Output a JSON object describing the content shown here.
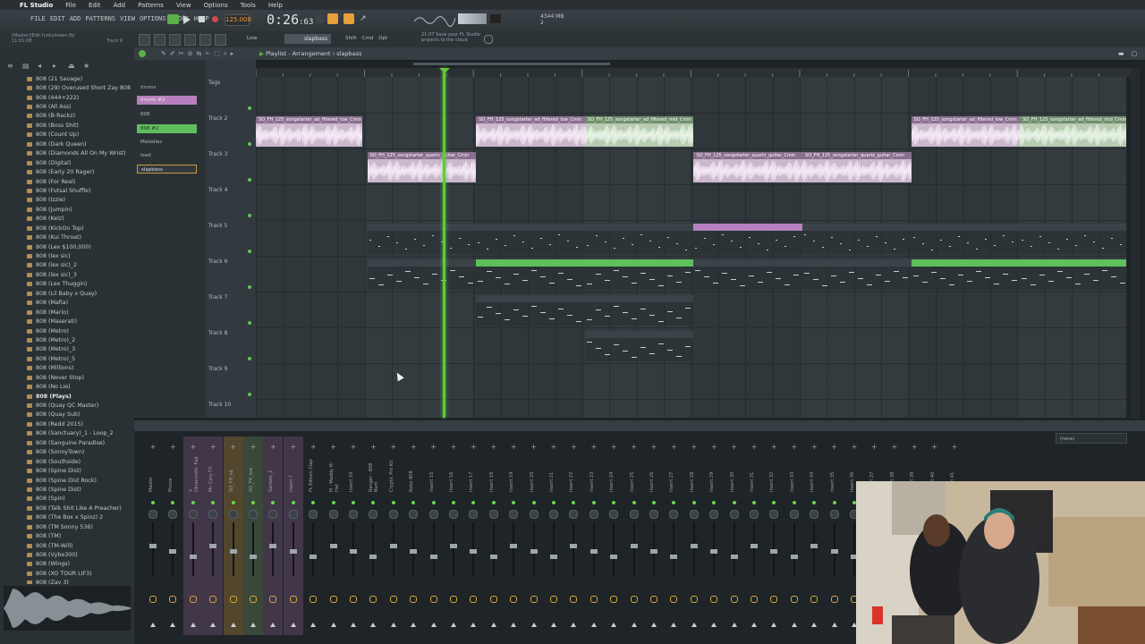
{
  "mac_menubar": {
    "apple": "",
    "app_name": "FL Studio",
    "items": [
      "File",
      "Edit",
      "Add",
      "Patterns",
      "View",
      "Options",
      "Tools",
      "Help"
    ]
  },
  "fl_menu": [
    "FILE",
    "EDIT",
    "ADD",
    "PATTERNS",
    "VIEW",
    "OPTIONS",
    "TOOLS",
    "HELP"
  ],
  "transport": {
    "tempo": "125.000",
    "time_main": "0:26",
    "time_fraction": ":63",
    "memory": "4344 MB",
    "memory_sub": "2"
  },
  "project_info": {
    "line1": "(Master)\\Edit funkylowen.flp",
    "line2": "11:01:08",
    "track": "Track 9"
  },
  "hint_bar": {
    "line1": "21:07  Save your FL Studio",
    "line2": "projects to the cloud"
  },
  "second_toolbar": {
    "mode": "Line",
    "pattern_selector": "slapbass",
    "snap_labels": [
      "Shift",
      "Cmd",
      "Opt"
    ]
  },
  "playlist": {
    "breadcrumb_prefix": "Playlist - Arrangement",
    "breadcrumb_pattern": "slapbass",
    "tracks": [
      "Tags",
      "Track 2",
      "Track 3",
      "Track 4",
      "Track 5",
      "Track 6",
      "Track 7",
      "Track 8",
      "Track 9",
      "Track 10"
    ],
    "patterns": [
      "drums",
      "drums #2",
      "808",
      "808 #2",
      "Melodies",
      "lead",
      "slapbass"
    ],
    "clips": [
      {
        "lane": 1,
        "kind": "audio",
        "color": "pink",
        "label": "SO_FH_125_songstarter_ad_filtered_low_Cmin",
        "start": 0,
        "end": 3.9
      },
      {
        "lane": 1,
        "kind": "audio",
        "color": "pink",
        "label": "SO_FH_125_songstarter_ad_filtered_low_Cmin",
        "start": 8.1,
        "end": 12.1
      },
      {
        "lane": 1,
        "kind": "audio",
        "color": "green",
        "label": "SO_FH_125_songstarter_ad_filtered_mid_Cmin",
        "start": 12.1,
        "end": 16.1
      },
      {
        "lane": 1,
        "kind": "audio",
        "color": "pink",
        "label": "SO_FH_125_songstarter_ad_filtered_low_Cmin",
        "start": 24.1,
        "end": 28.1
      },
      {
        "lane": 1,
        "kind": "audio",
        "color": "green",
        "label": "SO_FH_125_songstarter_ad_filtered_mid_Cmin",
        "start": 28.1,
        "end": 32
      },
      {
        "lane": 2,
        "kind": "audio",
        "color": "pink",
        "label": "SO_FH_125_songstarter_quartz_guitar_Cmin",
        "start": 4.1,
        "end": 8.1
      },
      {
        "lane": 2,
        "kind": "audio",
        "color": "pink",
        "label": "SO_FH_125_songstarter_quartz_guitar_Cmin",
        "start": 16.1,
        "end": 20.1
      },
      {
        "lane": 2,
        "kind": "audio",
        "color": "pink",
        "label": "SO_FH_125_songstarter_quartz_guitar_Cmin",
        "start": 20.1,
        "end": 24.1
      },
      {
        "lane": 4,
        "kind": "pattern",
        "color": "grey",
        "label": "drums",
        "start": 4.1,
        "end": 8.1
      },
      {
        "lane": 4,
        "kind": "pattern",
        "color": "grey",
        "label": "drums",
        "start": 8.1,
        "end": 12.1
      },
      {
        "lane": 4,
        "kind": "pattern",
        "color": "grey",
        "label": "drums",
        "start": 12.1,
        "end": 16.1
      },
      {
        "lane": 4,
        "kind": "pattern",
        "color": "pink",
        "label": "drums #2",
        "start": 16.1,
        "end": 20.1
      },
      {
        "lane": 4,
        "kind": "pattern",
        "color": "grey",
        "label": "drums",
        "start": 20.1,
        "end": 24.1
      },
      {
        "lane": 4,
        "kind": "pattern",
        "color": "grey",
        "label": "drums",
        "start": 24.1,
        "end": 28.1
      },
      {
        "lane": 4,
        "kind": "pattern",
        "color": "grey",
        "label": "drums",
        "start": 28.1,
        "end": 32
      },
      {
        "lane": 5,
        "kind": "pattern",
        "color": "grey",
        "label": "808",
        "start": 4.1,
        "end": 8.1
      },
      {
        "lane": 5,
        "kind": "pattern",
        "color": "green",
        "label": "808 #2",
        "start": 8.1,
        "end": 12.1
      },
      {
        "lane": 5,
        "kind": "pattern",
        "color": "green",
        "label": "808 #2",
        "start": 12.1,
        "end": 16.1
      },
      {
        "lane": 5,
        "kind": "pattern",
        "color": "grey",
        "label": "808",
        "start": 16.1,
        "end": 20.1
      },
      {
        "lane": 5,
        "kind": "pattern",
        "color": "grey",
        "label": "808",
        "start": 20.1,
        "end": 24.1
      },
      {
        "lane": 5,
        "kind": "pattern",
        "color": "green",
        "label": "808 #2",
        "start": 24.1,
        "end": 28.1
      },
      {
        "lane": 5,
        "kind": "pattern",
        "color": "green",
        "label": "808 #2",
        "start": 28.1,
        "end": 32
      },
      {
        "lane": 6,
        "kind": "pattern",
        "color": "grey",
        "label": "Melodies",
        "start": 8.1,
        "end": 12.1
      },
      {
        "lane": 6,
        "kind": "pattern",
        "color": "grey",
        "label": "lead",
        "start": 12.1,
        "end": 16.1
      },
      {
        "lane": 7,
        "kind": "pattern",
        "color": "grey",
        "label": "slapbass",
        "start": 12.1,
        "end": 16.1
      }
    ]
  },
  "browser_items": [
    "808 (21 Savage)",
    "808 (29) Overused Short Zay 808",
    "808 (444+222)",
    "808 (All Ass)",
    "808 (B-Rackz)",
    "808 (Boss Shit)",
    "808 (Count Up)",
    "808 (Dark Queen)",
    "808 (Diamonds All On My Wrist)",
    "808 (Digital)",
    "808 (Early 20 Rager)",
    "808 (For Real)",
    "808 (Futsal Shuffle)",
    "808 (Izzie)",
    "808 (Jumpin)",
    "808 (Kelz)",
    "808 (KickOn Top)",
    "808 (Kui Throat)",
    "808 (Lex $100,000)",
    "808 (lex sic)",
    "808 (lex sic)_2",
    "808 (lex sic)_3",
    "808 (Lex Thuggin)",
    "808 (Lil Baby x Quay)",
    "808 (Mafia)",
    "808 (Marlo)",
    "808 (Maserati)",
    "808 (Metro)",
    "808 (Metro)_2",
    "808 (Metro)_3",
    "808 (Metro)_5",
    "808 (Millions)",
    "808 (Never Stop)",
    "808 (No Lie)",
    "808 (Plays)",
    "808 (Quay QC Master)",
    "808 (Quay Sub)",
    "808 (Redd 2015)",
    "808 (Sanctuary)_1 - Loop_2",
    "808 (Sanguine Paradise)",
    "808 (SonnyTown)",
    "808 (Southside)",
    "808 (Spine Dist)",
    "808 (Spine Dist Rock)",
    "808 (Spine Dist)",
    "808 (Spin)",
    "808 (Talk Shit Like A Preacher)",
    "808 (The Box x Spinz) 2",
    "808 (TM Sonny 536)",
    "808 (TM)",
    "808 (TM-Will)",
    "808 (Vybe300)",
    "808 (Wings)",
    "808 (XO TOUR LIF3)",
    "808 (Zay 3)"
  ],
  "browser_bold_index": 34,
  "mixer": {
    "strips": [
      "Master",
      "Phone",
      "X Ukravinstly_Fad",
      "Mr. Cory FX",
      "SO_FH_sd",
      "SO_FH_low",
      "Sample_2",
      "Insert 7",
      "FL Edison Clap",
      "Pl - Maddy Hi Hat",
      "Insert 10",
      "Ranger - 808 Bum",
      "Cryptic Pro Kit",
      "Robo 808",
      "Insert 15",
      "Insert 16",
      "Insert 17",
      "Insert 18",
      "Insert 19",
      "Insert 20",
      "Insert 21",
      "Insert 22",
      "Insert 23",
      "Insert 24",
      "Insert 25",
      "Insert 26",
      "Insert 27",
      "Insert 28",
      "Insert 29",
      "Insert 30",
      "Insert 31",
      "Insert 32",
      "Insert 33",
      "Insert 34",
      "Insert 35",
      "Insert 36",
      "Insert 37",
      "Insert 38",
      "Insert 39",
      "Insert 40",
      "Insert 41"
    ],
    "right_selector": "(none)"
  },
  "colors": {
    "accent_green": "#62c93c",
    "clip_pink": "#b77fbd",
    "clip_green": "#5fbf5e",
    "tempo_orange": "#f09a3a"
  }
}
